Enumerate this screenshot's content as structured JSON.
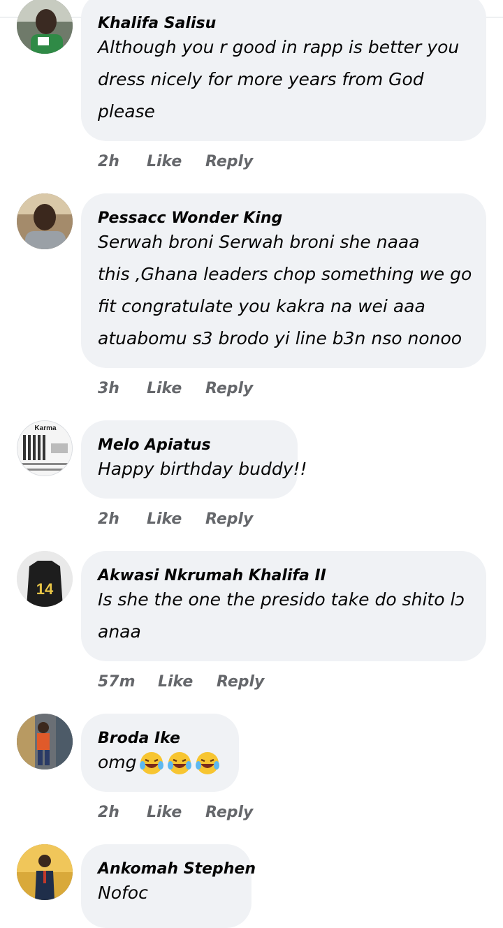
{
  "comments": [
    {
      "author": "Khalifa Salisu",
      "lines": [
        "Although you r good in  rapp is better you",
        "dress nicely for more years from God",
        "please"
      ],
      "time": "2h",
      "like": "Like",
      "reply": "Reply"
    },
    {
      "author": "Pessacc Wonder King",
      "lines": [
        "Serwah broni Serwah broni she naaa",
        "this ,Ghana leaders chop something we go",
        "fit congratulate you kakra na wei aaa",
        "atuabomu s3 brodo yi line b3n nso nonoo"
      ],
      "time": "3h",
      "like": "Like",
      "reply": "Reply"
    },
    {
      "author": "Melo Apiatus",
      "lines": [
        "Happy birthday buddy!!"
      ],
      "time": "2h",
      "like": "Like",
      "reply": "Reply",
      "avatar_text": "Karma"
    },
    {
      "author": "Akwasi Nkrumah Khalifa II",
      "lines": [
        "Is she the one the presido take do shito lɔ",
        "anaa"
      ],
      "time": "57m",
      "like": "Like",
      "reply": "Reply",
      "avatar_text": "14"
    },
    {
      "author": "Broda Ike",
      "lines": [
        "omg"
      ],
      "emoji": [
        "rolling-on-floor-laughing",
        "rolling-on-floor-laughing",
        "rolling-on-floor-laughing"
      ],
      "time": "2h",
      "like": "Like",
      "reply": "Reply"
    },
    {
      "author": "Ankomah Stephen",
      "lines": [
        "Nofoc"
      ]
    }
  ],
  "colors": {
    "bubble": "#f0f2f5",
    "meta_text": "#65676b",
    "text": "#050505"
  }
}
